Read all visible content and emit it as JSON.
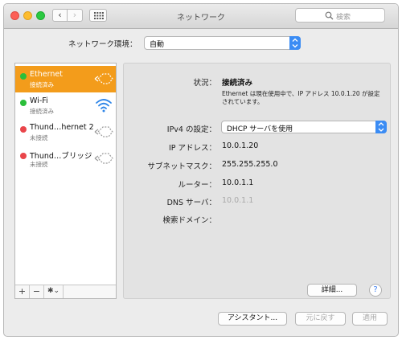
{
  "window": {
    "title": "ネットワーク",
    "search_placeholder": "検索",
    "back_glyph": "‹",
    "forward_glyph": "›"
  },
  "location": {
    "label": "ネットワーク環境：",
    "value": "自動"
  },
  "services": [
    {
      "name": "Ethernet",
      "status": "接続済み",
      "dot": "#2bbf3a",
      "icon": "ethernet-icon",
      "selected": true
    },
    {
      "name": "Wi-Fi",
      "status": "接続済み",
      "dot": "#2bbf3a",
      "icon": "wifi-icon",
      "selected": false
    },
    {
      "name": "Thund…hernet 2",
      "status": "未接続",
      "dot": "#e9454a",
      "icon": "ethernet-icon",
      "selected": false
    },
    {
      "name": "Thund…ブリッジ",
      "status": "未接続",
      "dot": "#e9454a",
      "icon": "ethernet-icon",
      "selected": false
    }
  ],
  "sidebar_tools": {
    "add": "+",
    "remove": "−",
    "action": "✱⌄"
  },
  "details": {
    "status_label": "状況：",
    "status_value": "接続済み",
    "status_desc": "Ethernet は現在使用中で、IP アドレス 10.0.1.20 が設定されています。",
    "ipv4_label": "IPv4 の設定：",
    "ipv4_value": "DHCP サーバを使用",
    "ip_label": "IP アドレス：",
    "ip_value": "10.0.1.20",
    "subnet_label": "サブネットマスク：",
    "subnet_value": "255.255.255.0",
    "router_label": "ルーター：",
    "router_value": "10.0.1.1",
    "dns_label": "DNS サーバ：",
    "dns_value": "10.0.1.1",
    "domain_label": "検索ドメイン：",
    "advanced_button": "詳細...",
    "help": "?"
  },
  "footer": {
    "assistant": "アシスタント...",
    "revert": "元に戻す",
    "apply": "適用"
  },
  "colors": {
    "selection": "#f39c1b",
    "accent": "#3b8cf4",
    "connected": "#2bbf3a",
    "disconnected": "#e9454a"
  }
}
